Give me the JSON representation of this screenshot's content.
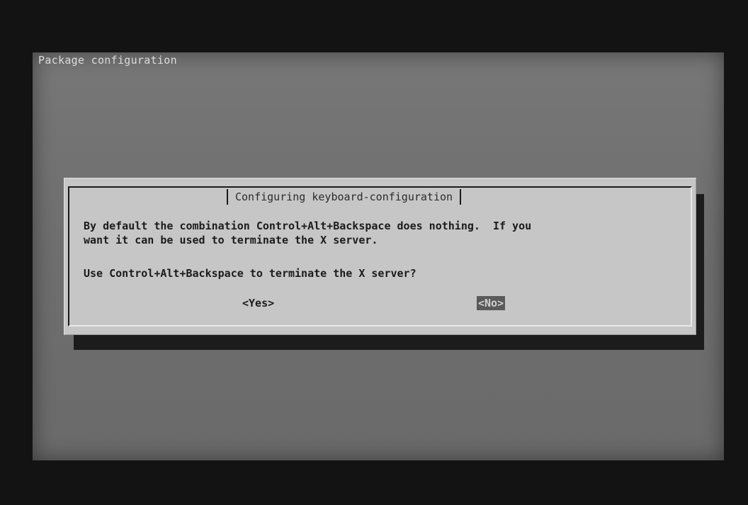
{
  "screen": {
    "title": "Package configuration"
  },
  "dialog": {
    "title": "Configuring keyboard-configuration",
    "message_lines": [
      "By default the combination Control+Alt+Backspace does nothing.  If you",
      "want it can be used to terminate the X server."
    ],
    "question": "Use Control+Alt+Backspace to terminate the X server?",
    "buttons": {
      "yes": "<Yes>",
      "no": "<No>",
      "selected": "no"
    }
  },
  "colors": {
    "background": "#131313",
    "screen": "#727272",
    "dialog": "#c6c6c6",
    "selected_button": "#5a5a5a"
  }
}
